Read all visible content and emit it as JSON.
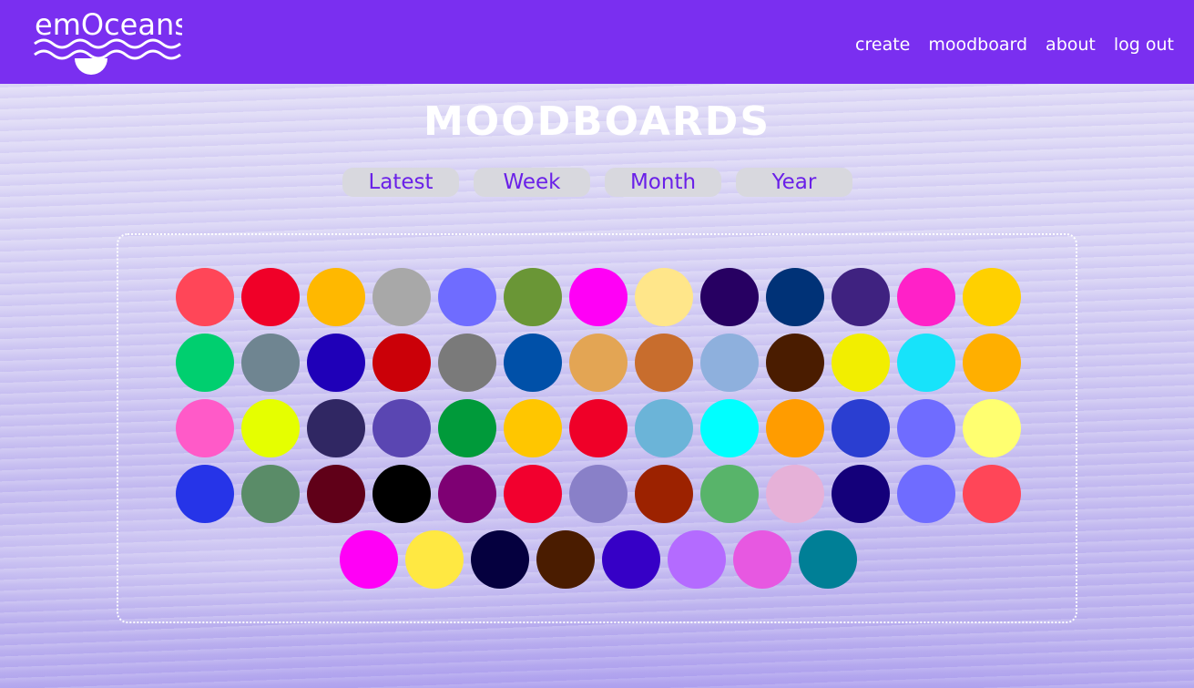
{
  "header": {
    "logo_text": "emOceans",
    "nav": [
      {
        "label": "create"
      },
      {
        "label": "moodboard"
      },
      {
        "label": "about"
      },
      {
        "label": "log out"
      }
    ],
    "colors": {
      "bar": "#7a2ff0",
      "text": "#ffffff"
    }
  },
  "page": {
    "title": "MOODBOARDS"
  },
  "filters": [
    {
      "label": "Latest"
    },
    {
      "label": "Week"
    },
    {
      "label": "Month"
    },
    {
      "label": "Year"
    }
  ],
  "moods": [
    "#ff4658",
    "#f00028",
    "#ffb800",
    "#a8a8a8",
    "#6f6cff",
    "#6a9636",
    "#ff00f6",
    "#ffe68a",
    "#270062",
    "#003277",
    "#3f2280",
    "#ff21c8",
    "#ffd000",
    "#00cf6f",
    "#6f8591",
    "#1f00b8",
    "#cb0008",
    "#7a7a7a",
    "#0050a8",
    "#e3a554",
    "#c86d2d",
    "#8eb0dd",
    "#4a1c00",
    "#f2ee00",
    "#17e3fa",
    "#ffaf00",
    "#ff5ac8",
    "#e5ff00",
    "#302763",
    "#5a46b2",
    "#009a3a",
    "#ffc600",
    "#ef0028",
    "#6bb4d8",
    "#00ffff",
    "#ff9c00",
    "#2a3ed1",
    "#6f6cff",
    "#ffff70",
    "#2634e8",
    "#5a8c68",
    "#600018",
    "#000000",
    "#7e0073",
    "#f2002e",
    "#8980c8",
    "#9c2200",
    "#58b46a",
    "#e6b1d8",
    "#14007a",
    "#6f6cff",
    "#ff4658",
    "#ff00f6",
    "#ffe842",
    "#05003f",
    "#4a1c00",
    "#3600c6",
    "#b46bff",
    "#e758e1",
    "#007f96"
  ]
}
